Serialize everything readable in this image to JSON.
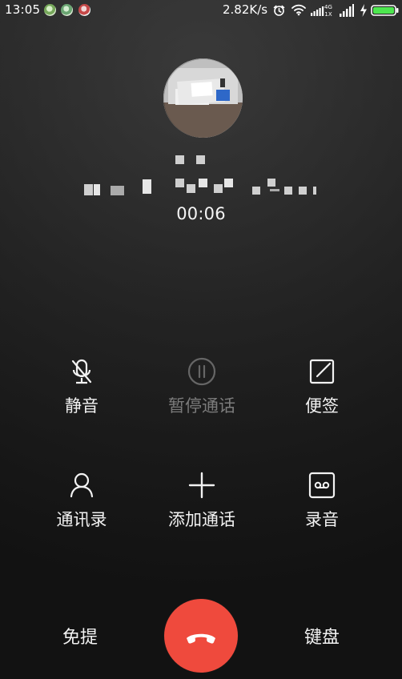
{
  "status_bar": {
    "time": "13:05",
    "network_speed": "2.82K/s",
    "notification_icons": [
      "app-icon-green-1",
      "app-icon-green-2",
      "app-icon-red"
    ],
    "right_icons": [
      "alarm-icon",
      "wifi-icon",
      "signal-4g-icon",
      "signal-1x-icon",
      "signal-bars-icon",
      "charging-bolt-icon",
      "battery-icon"
    ]
  },
  "caller": {
    "avatar_icon": "caller-avatar-photo",
    "number": "1 3           ",
    "timer": "00:06"
  },
  "actions": [
    {
      "label": "静音",
      "icon": "mute-mic-icon"
    },
    {
      "label": "暂停通话",
      "icon": "pause-circle-icon"
    },
    {
      "label": "便签",
      "icon": "note-edit-icon"
    },
    {
      "label": "通讯录",
      "icon": "contacts-person-icon"
    },
    {
      "label": "添加通话",
      "icon": "plus-icon"
    },
    {
      "label": "录音",
      "icon": "record-tape-icon"
    }
  ],
  "bottom_bar": {
    "speaker_label": "免提",
    "keypad_label": "键盘",
    "end_call_icon": "hangup-phone-icon"
  },
  "colors": {
    "end_call": "#ef4a3d",
    "text": "#f2f2f2",
    "disabled_text": "#7b7b7b"
  }
}
